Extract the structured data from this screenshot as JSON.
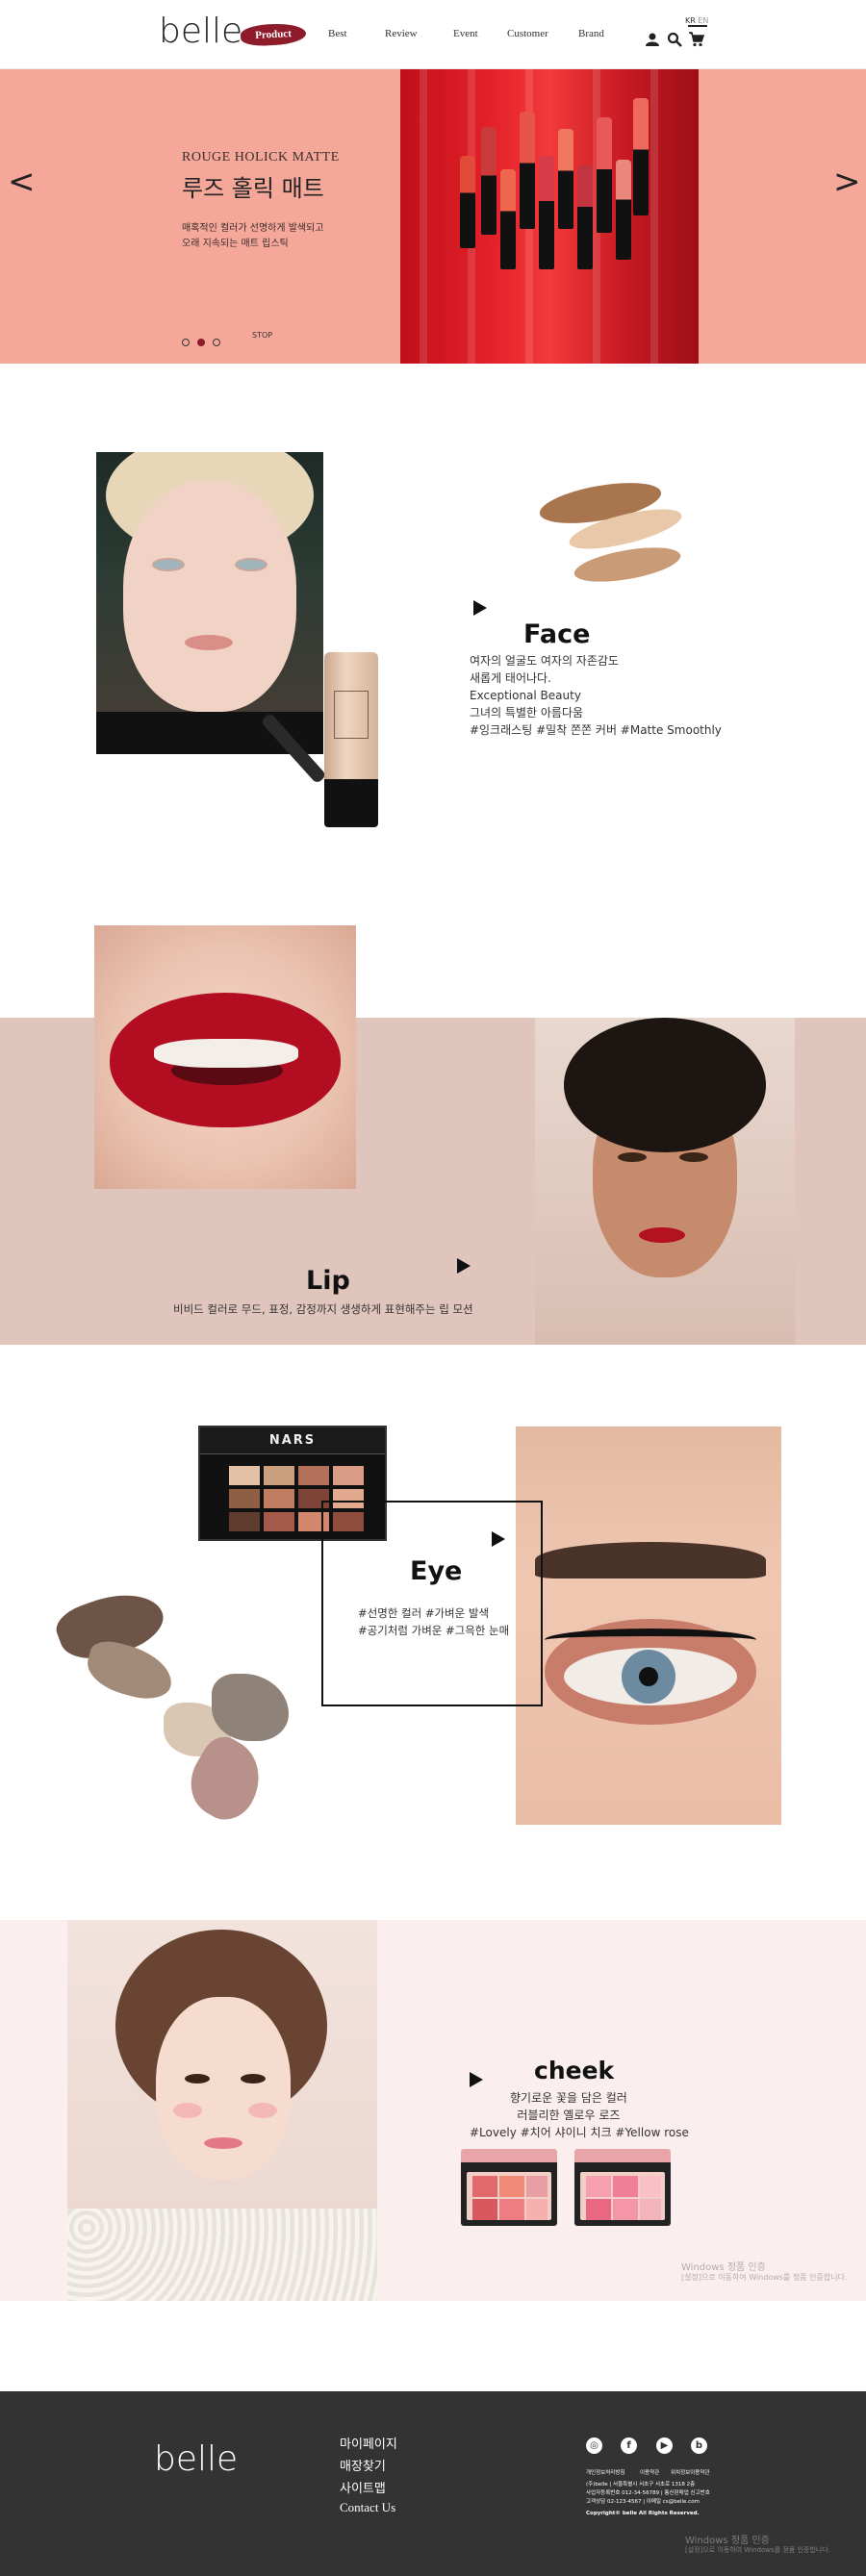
{
  "header": {
    "logo": "belle",
    "nav": [
      "Product",
      "Best",
      "Review",
      "Event",
      "Customer",
      "Brand"
    ],
    "lang_kr": "KR",
    "lang_en": "EN"
  },
  "hero": {
    "subtitle": "ROUGE HOLICK MATTE",
    "title": "루즈 홀릭 매트",
    "desc_line1": "매혹적인 컬러가 선명하게 발색되고",
    "desc_line2": "오래 지속되는 매트 립스틱",
    "prev": "<",
    "next": ">",
    "stop": "STOP",
    "active_slide": 2,
    "slides": 3
  },
  "face": {
    "title": "Face",
    "lines": [
      "여자의 얼굴도 여자의 자존감도",
      "새롭게 태어나다.",
      "Exceptional Beauty",
      "그녀의 특별한 아름다움",
      "#잉크래스팅 #밀착 쫀쫀 커버 #Matte Smoothly"
    ]
  },
  "lip": {
    "title": "Lip",
    "desc": "비비드 컬러로 무드, 표정, 감정까지 생생하게 표현해주는 립 모션"
  },
  "eye": {
    "title": "Eye",
    "line1": "#선명한 컬러 #가벼운 발색",
    "line2": "#공기처럼 가벼운 #그윽한 눈매",
    "palette_brand": "NARS"
  },
  "cheek": {
    "title": "cheek",
    "line1": "향기로운 꽃을 담은 컬러",
    "line2": "러블리한 옐로우 로즈",
    "tags": "#Lovely #치어 샤이니 치크 #Yellow rose"
  },
  "footer": {
    "logo": "belle",
    "links": [
      "마이페이지",
      "매장찾기",
      "사이트맵",
      "Contact Us"
    ],
    "sns": [
      "instagram",
      "facebook",
      "youtube",
      "blog"
    ],
    "sns_glyphs": [
      "◎",
      "f",
      "▶",
      "b"
    ],
    "info_row1": [
      "개인정보처리방침",
      "이용약관",
      "위치정보이용약관"
    ],
    "info_row2": "(주)belle  |  서울특별시 서초구 서초로 1318 2층",
    "info_row3": "사업자등록번호 012-34-56789  |  통신판매업 신고번호",
    "info_row4": "고객상담 02-123-4567  |  이메일 cs@belle.com",
    "copyright": "Copyright© belle All Rights Reserved."
  },
  "watermarks": {
    "line1": "Windows 정품 인증",
    "line2": "[설정]으로 이동하여 Windows를 정품 인증합니다."
  }
}
